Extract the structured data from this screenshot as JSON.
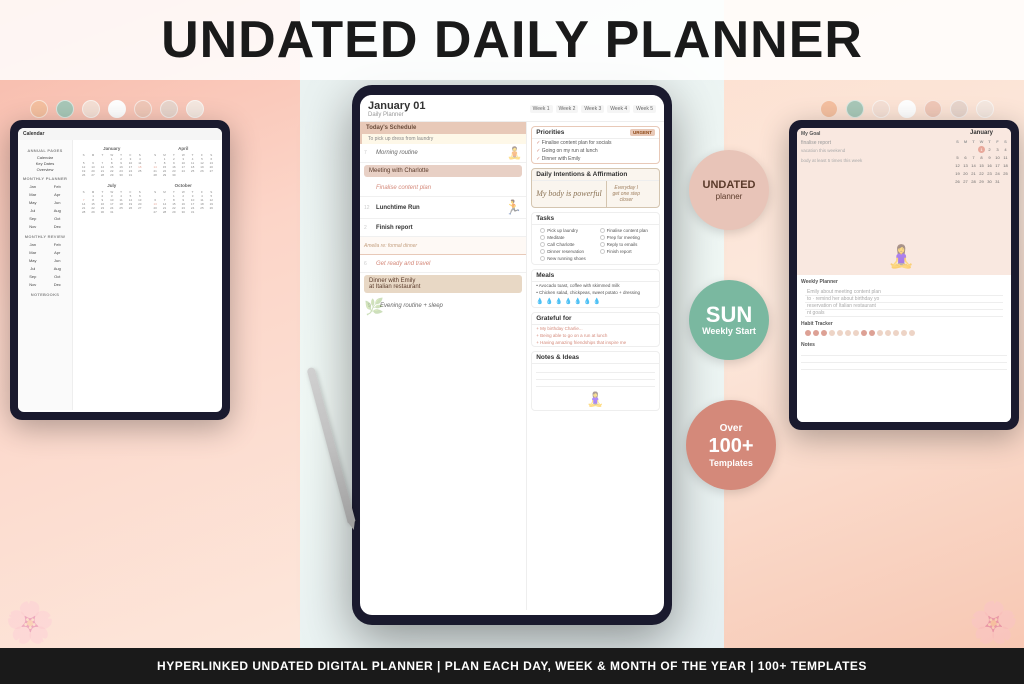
{
  "page": {
    "title": "UNDATED DAILY PLANNER",
    "bottom_tagline": "HYPERLINKED UNDATED DIGITAL PLANNER | PLAN EACH DAY, WEEK & MONTH OF THE YEAR | 100+ TEMPLATES"
  },
  "colors": {
    "left_bg": "#f7b8a8",
    "right_bg": "#fde0d0",
    "center_bg": "#e8f0f0",
    "accent_coral": "#d4897a",
    "accent_teal": "#7ab8a0",
    "dark": "#1a1a2e",
    "white": "#ffffff"
  },
  "dots_left": [
    "#f5c0a0",
    "#a8c8b8",
    "#f5e0d5",
    "#ffffff",
    "#f0c8b8",
    "#e8d5cc",
    "#f5e8e0"
  ],
  "dots_right": [
    "#f5c0a0",
    "#a8c8b8",
    "#f5e0d5",
    "#ffffff",
    "#f0c8b8",
    "#e8d5cc",
    "#f5e8e0"
  ],
  "center_tablet": {
    "date": "January 01",
    "subtitle": "Daily Planner",
    "week_tabs": [
      "Week 1",
      "Week 2",
      "Week 3",
      "Week 4",
      "Week 5"
    ],
    "schedule_header": "Today's Schedule",
    "schedule_note": "To pick up dress from laundry",
    "events": [
      {
        "time": "7",
        "label": "Morning routine"
      },
      {
        "time": "9",
        "label": "Meeting with Charlotte",
        "type": "bold"
      },
      {
        "time": "",
        "label": "Finalise content plan",
        "type": "pink"
      },
      {
        "time": "12",
        "label": "Lunchtime Run"
      },
      {
        "time": "2",
        "label": "Finish report"
      },
      {
        "time": "6",
        "label": "Get ready and travel"
      },
      {
        "time": "7",
        "label": "Dinner with Emily at Italian restaurant",
        "type": "bold"
      },
      {
        "time": "9",
        "label": "Evening routine + sleep"
      }
    ],
    "priorities_title": "Priorities",
    "urgent_label": "URGENT",
    "priorities": [
      "Finalise content plan for socials",
      "Going on my run at lunch",
      "Dinner with Emily"
    ],
    "intentions_title": "Daily Intentions & Affirmation",
    "affirmation": "My body is powerful",
    "affirmation_note": "Everyday I get one step closer",
    "tasks_title": "Tasks",
    "tasks_left": [
      "Pick up laundry",
      "Meditate",
      "Call Charlotte",
      "Dinner reservation",
      "New running shoes"
    ],
    "tasks_right": [
      "Finalise content plan",
      "Prep for meeting",
      "Reply to emails",
      "Finish report"
    ],
    "meals_title": "Meals",
    "meals": [
      "Avocado toast, coffee with skimmed milk",
      "Chicken salad, chickpeas, sweet potato + dressing"
    ],
    "grateful_title": "Grateful for",
    "grateful": [
      "My birthday Charlie...",
      "Being able to go on a run at lunch",
      "Having amazing friendships that inspire me"
    ],
    "notes_title": "Notes & Ideas"
  },
  "left_tablet": {
    "header": "Calendar",
    "sidebar": {
      "annual_section": "ANNUAL PAGES",
      "annual_links": [
        "Calendar",
        "Key Dates",
        "Overview"
      ],
      "monthly_section": "MONTHLY PLANNER",
      "monthly_links": [
        "Jan",
        "Feb",
        "Mar",
        "Apr",
        "May",
        "Jun",
        "Jul",
        "Aug",
        "Sep",
        "Oct",
        "Nov",
        "Dec"
      ],
      "review_section": "MONTHLY REVIEW",
      "notebooks_section": "NOTEBOOKS"
    },
    "months": [
      "January",
      "April",
      "July",
      "October"
    ]
  },
  "right_tablet": {
    "goal_label": "My Goal",
    "calendar_month": "January",
    "planner_label": "Weekly Planner",
    "habit_label": "Habit Tracker",
    "notes_label": "Notes"
  },
  "badges": {
    "undated": {
      "line1": "UNDATED",
      "line2": "planner"
    },
    "sun": {
      "day": "SUN",
      "label": "Weekly Start"
    },
    "templates": {
      "over": "Over",
      "count": "100+",
      "label": "Templates"
    }
  }
}
